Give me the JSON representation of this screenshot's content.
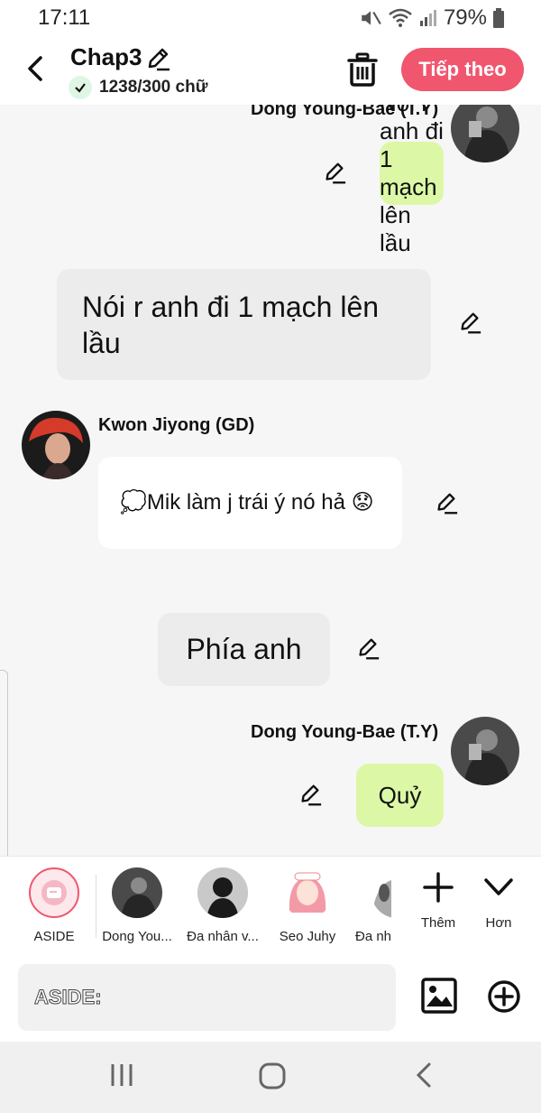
{
  "status": {
    "time": "17:11",
    "battery": "79%"
  },
  "header": {
    "title": "Chap3",
    "word_count": "1238/300 chữ",
    "next_label": "Tiếp theo"
  },
  "messages": [
    {
      "sender": "Dong Young-Bae (T.Y)",
      "text": "Ừ"
    },
    {
      "text": "Nói r anh đi 1 mạch lên lầu"
    },
    {
      "sender": "Kwon Jiyong (GD)",
      "text": "💭Mik làm j trái ý nó hả 😟"
    },
    {
      "text": "Phía anh"
    },
    {
      "sender": "Dong Young-Bae (T.Y)",
      "text": "Quỷ"
    }
  ],
  "characters": [
    {
      "label": "ASIDE"
    },
    {
      "label": "Dong You..."
    },
    {
      "label": "Đa nhân v..."
    },
    {
      "label": "Seo Juhy"
    },
    {
      "label": "Đa nh"
    }
  ],
  "tools": {
    "more_label": "Thêm",
    "less_label": "Hơn"
  },
  "input": {
    "placeholder": "ASIDE:"
  },
  "colors": {
    "accent": "#f0566e",
    "bubble_green": "#dcf8a6",
    "bubble_gray": "#ececec"
  }
}
